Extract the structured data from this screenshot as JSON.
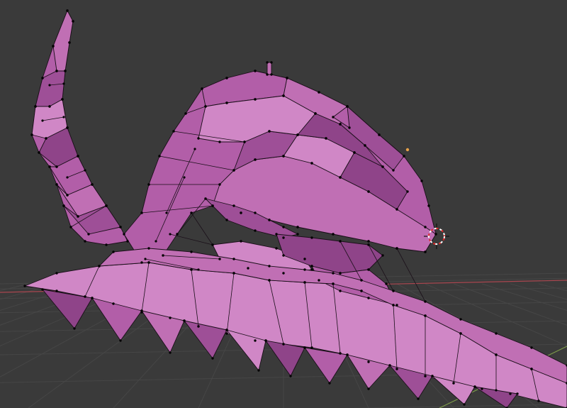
{
  "viewport": {
    "background": "#3a3a3a",
    "grid_color": "#464646",
    "mesh": {
      "object": "dragon-skull-mesh",
      "mode": "edit",
      "face_colors": [
        "#b25ea8",
        "#c06fb4",
        "#9e4f97",
        "#d087c6",
        "#8f4489"
      ],
      "edge_color": "#1a0f19",
      "vertex_color": "#050305"
    },
    "x_axis_color": "#a9464f",
    "y_axis_color": "#7d9b4a",
    "cursor_icon": "3d-cursor-icon",
    "light_icon": "light-icon",
    "light_color": "#e6a24a"
  }
}
